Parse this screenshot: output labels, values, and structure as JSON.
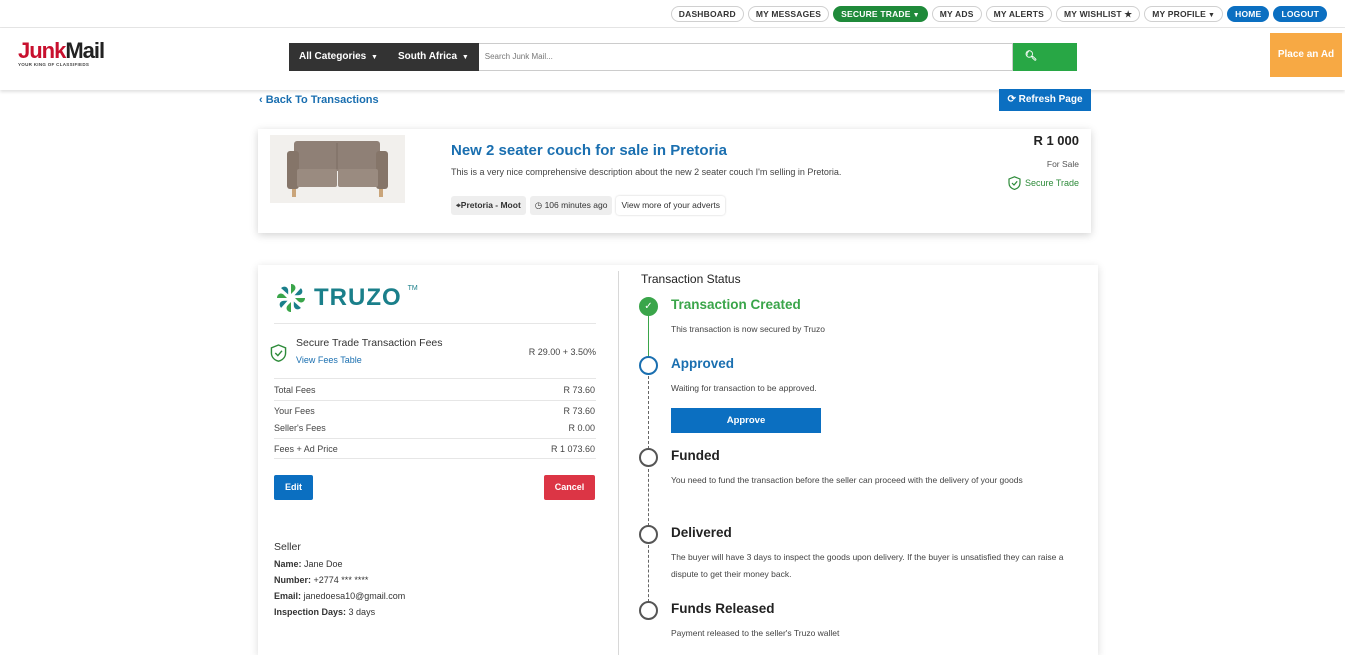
{
  "topnav": {
    "items": [
      {
        "label": "DASHBOARD"
      },
      {
        "label": "MY MESSAGES"
      },
      {
        "label": "SECURE TRADE"
      },
      {
        "label": "MY ADS"
      },
      {
        "label": "MY ALERTS"
      },
      {
        "label": "MY WISHLIST"
      },
      {
        "label": "MY PROFILE"
      },
      {
        "label": "HOME"
      },
      {
        "label": "LOGOUT"
      }
    ]
  },
  "header": {
    "logo_junk": "Junk",
    "logo_mail": "Mail",
    "logo_tagline": "YOUR KING OF CLASSIFIEDS",
    "category": "All Categories",
    "region": "South Africa",
    "search_placeholder": "Search Junk Mail...",
    "search_label": "Search",
    "place_ad": "Place an Ad"
  },
  "page": {
    "back_label": "Back To Transactions",
    "refresh_label": "Refresh Page"
  },
  "ad": {
    "title": "New 2 seater couch for sale in Pretoria",
    "description": "This is a very nice comprehensive description about the new 2 seater couch I'm selling in Pretoria.",
    "location": "Pretoria - Moot",
    "time": "106 minutes ago",
    "more_link": "View more of your adverts",
    "price": "R 1 000",
    "sale_type": "For Sale",
    "secure_trade": "Secure Trade"
  },
  "fees": {
    "brand": "TRUZO",
    "tm": "TM",
    "title": "Secure Trade Transaction Fees",
    "table_link": "View Fees Table",
    "rate": "R 29.00 + 3.50%",
    "rows": [
      {
        "label": "Total Fees",
        "value": "R 73.60"
      },
      {
        "label": "Your Fees",
        "value": "R 73.60"
      },
      {
        "label": "Seller's Fees",
        "value": "R 0.00"
      },
      {
        "label": "Fees + Ad Price",
        "value": "R 1 073.60"
      }
    ],
    "edit_label": "Edit",
    "cancel_label": "Cancel"
  },
  "seller": {
    "heading": "Seller",
    "name_label": "Name:",
    "name": "Jane Doe",
    "number_label": "Number:",
    "number": "+2774 *** ****",
    "email_label": "Email:",
    "email": "janedoesa10@gmail.com",
    "days_label": "Inspection Days:",
    "days": "3 days"
  },
  "status": {
    "title": "Transaction Status",
    "steps": [
      {
        "name": "Transaction Created",
        "desc": "This transaction is now secured by Truzo"
      },
      {
        "name": "Approved",
        "desc": "Waiting for transaction to be approved.",
        "action": "Approve"
      },
      {
        "name": "Funded",
        "desc": "You need to fund the transaction before the seller can proceed with the delivery of your goods"
      },
      {
        "name": "Delivered",
        "desc": "The buyer will have 3 days to inspect the goods upon delivery. If the buyer is unsatisfied they can raise a dispute to get their money back."
      },
      {
        "name": "Funds Released",
        "desc": "Payment released to the seller's Truzo wallet"
      }
    ]
  },
  "colors": {
    "brand_blue": "#0b6fc1",
    "secure_green": "#1f8a3a",
    "place_ad_orange": "#f7a944",
    "cancel_red": "#dc3545",
    "truzo_teal": "#1a7f8a"
  }
}
